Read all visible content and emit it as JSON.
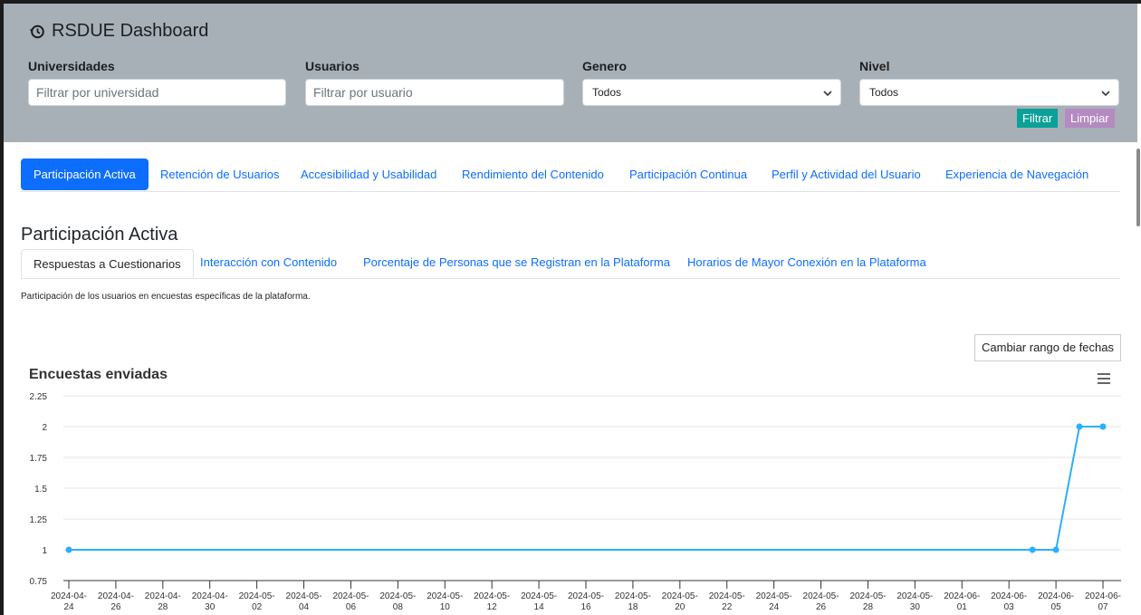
{
  "header": {
    "title": "RSDUE Dashboard",
    "filters": {
      "universidades": {
        "label": "Universidades",
        "placeholder": "Filtrar por universidad"
      },
      "usuarios": {
        "label": "Usuarios",
        "placeholder": "Filtrar por usuario"
      },
      "genero": {
        "label": "Genero",
        "selected": "Todos"
      },
      "nivel": {
        "label": "Nivel",
        "selected": "Todos"
      }
    },
    "filter_button": "Filtrar",
    "clear_button": "Limpiar"
  },
  "nav": {
    "tabs": [
      {
        "label": "Participación Activa",
        "active": true
      },
      {
        "label": "Retención de Usuarios"
      },
      {
        "label": "Accesibilidad y Usabilidad"
      },
      {
        "label": "Rendimiento del Contenido"
      },
      {
        "label": "Participación Continua"
      },
      {
        "label": "Perfil y Actividad del Usuario"
      },
      {
        "label": "Experiencia de Navegación"
      }
    ]
  },
  "section": {
    "title": "Participación Activa",
    "subtabs": [
      {
        "label": "Respuestas a Cuestionarios",
        "active": true
      },
      {
        "label": "Interacción con Contenido"
      },
      {
        "label": "Porcentaje de Personas que se Registran en la Plataforma"
      },
      {
        "label": "Horarios de Mayor Conexión en la Plataforma"
      }
    ],
    "description": "Participación de los usuarios en encuestas específicas de la plataforma.",
    "date_range_button": "Cambiar rango de fechas"
  },
  "icons": {
    "brand": "history-icon",
    "menu": "hamburger-menu-icon",
    "select": "chevron-down-icon"
  },
  "colors": {
    "header_bg": "#a8b0b7",
    "primary": "#0d6efd",
    "filter_btn": "#0aa198",
    "clear_btn": "#b48ac0",
    "series": "#2caffe"
  },
  "chart_data": {
    "type": "line",
    "title": "Encuestas enviadas",
    "xlabel": "",
    "ylabel": "",
    "ylim": [
      0.75,
      2.25
    ],
    "yticks": [
      "0.75",
      "1",
      "1.25",
      "1.5",
      "1.75",
      "2",
      "2.25"
    ],
    "xlim": [
      "2024-04-24",
      "2024-06-07"
    ],
    "xticks": [
      "2024-04-24",
      "2024-04-26",
      "2024-04-28",
      "2024-04-30",
      "2024-05-02",
      "2024-05-04",
      "2024-05-06",
      "2024-05-08",
      "2024-05-10",
      "2024-05-12",
      "2024-05-14",
      "2024-05-16",
      "2024-05-18",
      "2024-05-20",
      "2024-05-22",
      "2024-05-24",
      "2024-05-26",
      "2024-05-28",
      "2024-05-30",
      "2024-06-01",
      "2024-06-03",
      "2024-06-05",
      "2024-06-07"
    ],
    "grid": true,
    "series": [
      {
        "points": [
          {
            "x": "2024-04-24",
            "y": 1
          },
          {
            "x": "2024-06-04",
            "y": 1
          },
          {
            "x": "2024-06-05",
            "y": 1
          },
          {
            "x": "2024-06-06",
            "y": 2
          },
          {
            "x": "2024-06-07",
            "y": 2
          }
        ]
      }
    ]
  }
}
